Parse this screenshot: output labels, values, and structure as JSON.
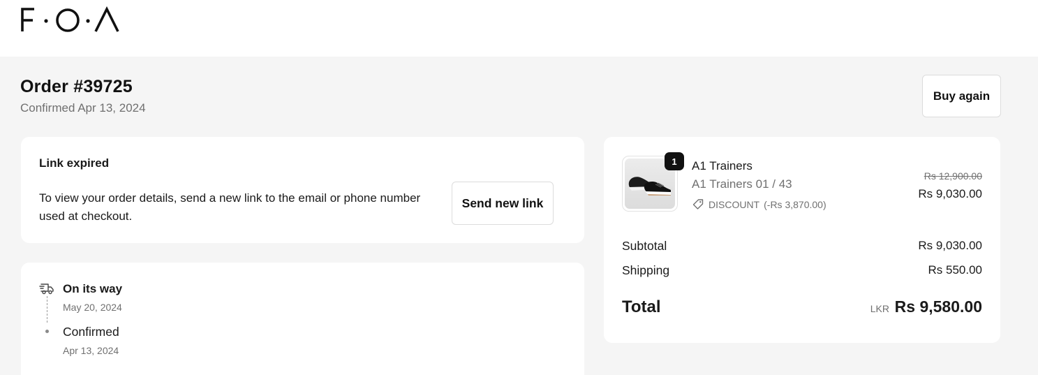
{
  "brand": {
    "logo_text": "F·O·Λ"
  },
  "order": {
    "title": "Order #39725",
    "subtitle": "Confirmed Apr 13, 2024",
    "buy_again_label": "Buy again"
  },
  "link_card": {
    "title": "Link expired",
    "text": "To view your order details, send a new link to the email or phone number used at checkout.",
    "button_label": "Send new link"
  },
  "timeline": {
    "events": [
      {
        "status": "On its way",
        "date": "May 20, 2024",
        "icon": "delivery-truck-icon"
      },
      {
        "status": "Confirmed",
        "date": "Apr 13, 2024",
        "icon": "dot-icon"
      }
    ]
  },
  "summary": {
    "item": {
      "name": "A1 Trainers",
      "variant": "A1 Trainers 01 / 43",
      "quantity": "1",
      "discount_label": "DISCOUNT",
      "discount_amount": "(-Rs 3,870.00)",
      "price_original": "Rs 12,900.00",
      "price_final": "Rs 9,030.00",
      "image_icon": "sneaker-image"
    },
    "subtotal_label": "Subtotal",
    "subtotal_value": "Rs 9,030.00",
    "shipping_label": "Shipping",
    "shipping_value": "Rs 550.00",
    "total_label": "Total",
    "total_currency": "LKR",
    "total_value": "Rs 9,580.00"
  }
}
